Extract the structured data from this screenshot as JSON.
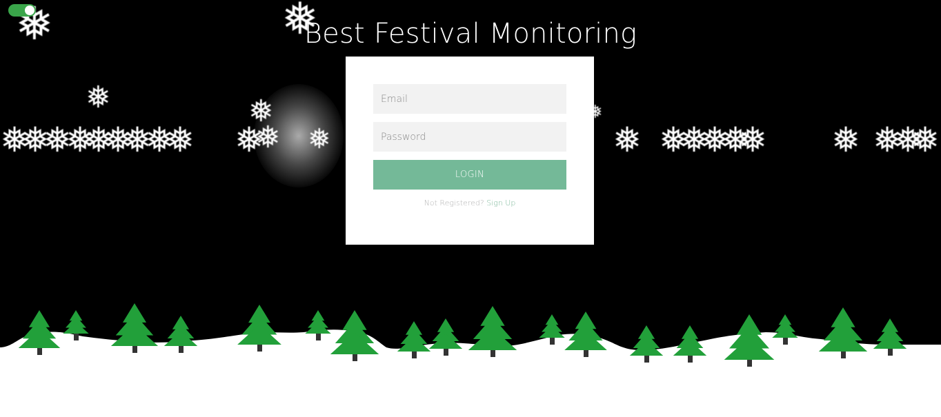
{
  "page": {
    "title": "Best Festival Monitoring"
  },
  "theme": {
    "background": "#000000",
    "accent": "#74b998",
    "toggle_on": "#3aa54a",
    "tree_color": "#22a03a",
    "snow_color": "#ffffff"
  },
  "toggle": {
    "state": "on",
    "icon": "toggle-switch-icon"
  },
  "login": {
    "email_placeholder": "Email",
    "password_placeholder": "Password",
    "button_label": "LOGIN",
    "register_prompt": "Not Registered?",
    "register_link": "Sign Up"
  },
  "decorations": {
    "snowflake_icon": "snowflake-icon",
    "tree_icon": "pine-tree-icon"
  }
}
